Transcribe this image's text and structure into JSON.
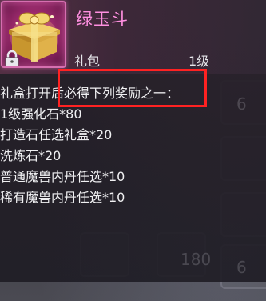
{
  "item": {
    "name": "绿玉斗",
    "type": "礼包",
    "level": "1级",
    "icon": "gift-box-icon",
    "locked_icon": "lock-icon"
  },
  "description": {
    "intro": "礼盒打开后必得下列奖励之一：",
    "rewards": [
      "1级强化石*80",
      "打造石任选礼盒*20",
      "洗炼石*20",
      "普通魔兽内丹任选*10",
      "稀有魔兽内丹任选*10"
    ]
  },
  "background": {
    "faint_text": [
      "6",
      "180",
      "6"
    ]
  },
  "colors": {
    "name": "#ff8fe0",
    "frame": "#d66fb0",
    "highlight": "#ff2222"
  }
}
